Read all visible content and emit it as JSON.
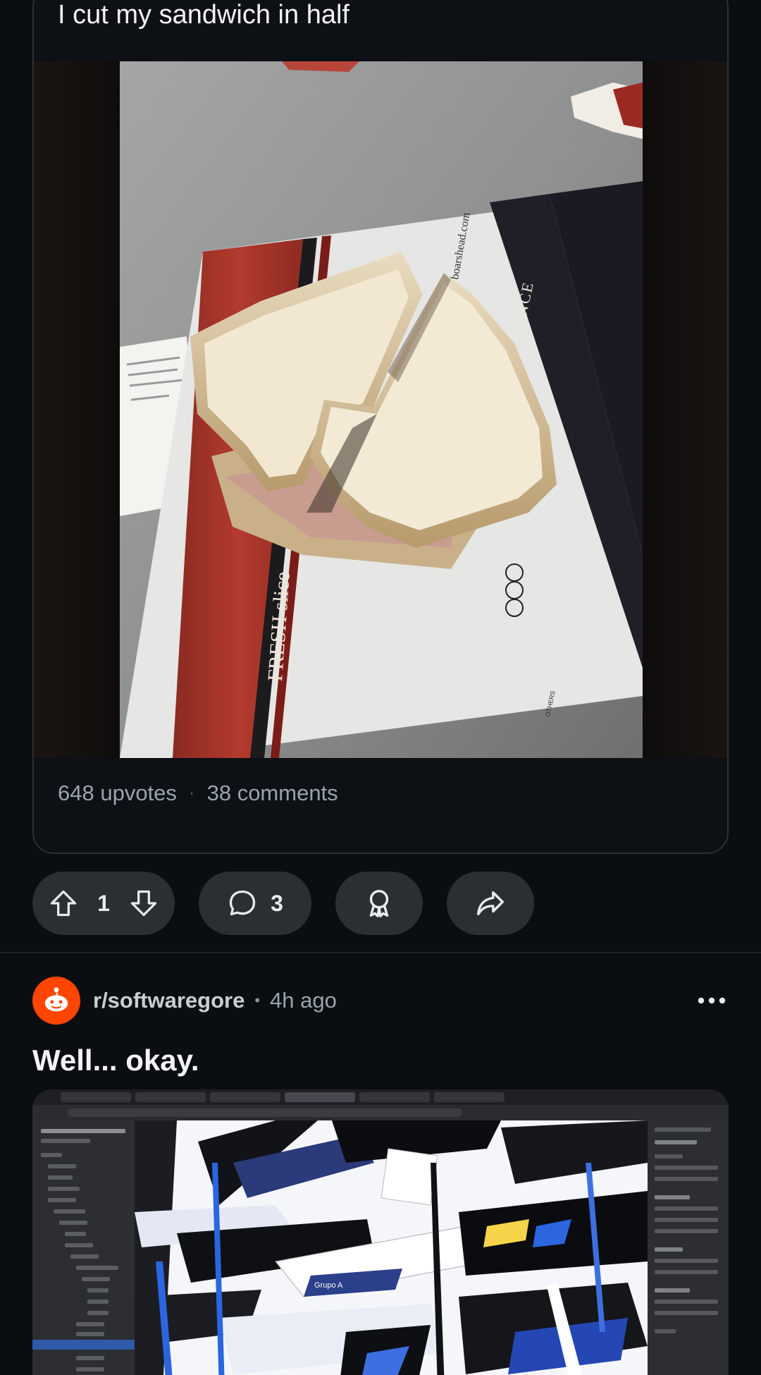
{
  "crosspost": {
    "title": "I cut my sandwich in half",
    "image_alt": "sandwich on a deli paper bag",
    "paper_print": {
      "fresh_slice": "FRESH slice",
      "heritage": "HERITAGE of EXCELLENCE",
      "website": "boarshead.com",
      "others": "OTHERS"
    },
    "upvotes_text": "648 upvotes",
    "comments_text": "38 comments"
  },
  "actions": {
    "vote_count": "1",
    "comment_count": "3"
  },
  "post": {
    "subreddit": "r/softwaregore",
    "time": "4h ago",
    "title": "Well... okay.",
    "image_alt": "glitched design app screenshot",
    "screenshot_label": "Grupo A"
  },
  "colors": {
    "background": "#0b0e11",
    "pill": "#2a2f34",
    "subreddit_avatar": "#ff4500"
  },
  "icons": [
    "upvote-icon",
    "downvote-icon",
    "comment-icon",
    "award-icon",
    "share-icon",
    "snoo-icon",
    "more-icon"
  ]
}
